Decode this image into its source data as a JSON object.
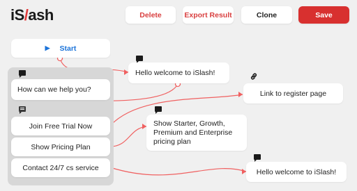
{
  "app": {
    "logo_prefix": "iS",
    "logo_slash": "/",
    "logo_suffix": "ash"
  },
  "toolbar": {
    "delete_label": "Delete",
    "export_label": "Export Result",
    "clone_label": "Clone",
    "save_label": "Save"
  },
  "flow": {
    "start_label": "Start",
    "welcome_message_1": "Hello welcome to iSlash!",
    "question_text": "How can we help you?",
    "options": [
      "Join Free Trial Now",
      "Show Pricing Plan",
      "Contact 24/7 cs service"
    ],
    "link_node_text": "Link to register page",
    "pricing_message": "Show Starter, Growth, Premium and Enterprise pricing plan",
    "welcome_message_2": "Hello welcome to iSlash!"
  },
  "colors": {
    "accent_red": "#d8302f",
    "connector": "#f06060",
    "start_blue": "#1b73d9"
  },
  "icons": [
    "message-icon",
    "link-icon",
    "play-icon"
  ]
}
